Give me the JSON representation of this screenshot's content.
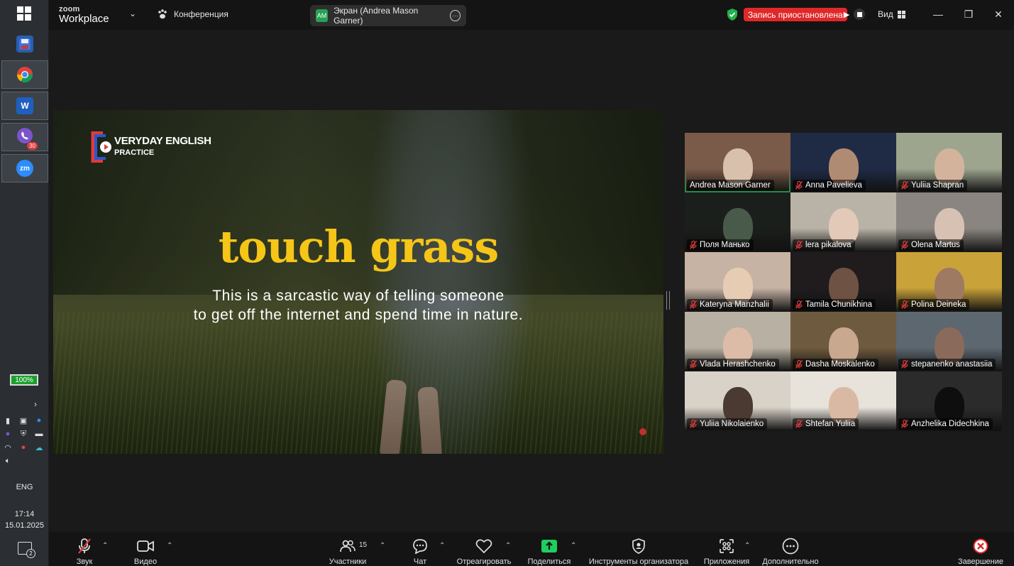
{
  "taskbar": {
    "battery": "100%",
    "language": "ENG",
    "time": "17:14",
    "date": "15.01.2025",
    "notifications": "2",
    "viber_badge": "30",
    "zoom_icon_label": "zm"
  },
  "zoom": {
    "brand_top": "zoom",
    "brand_main": "Workplace",
    "meeting_label": "Конференция",
    "share_pill": {
      "initials": "AM",
      "label": "Экран (Andrea Mason Garner)"
    },
    "recording_label": "Запись приостановлена",
    "view_label": "Вид"
  },
  "shared_screen": {
    "logo_line1": "VERYDAY ENGLISH",
    "logo_line2": "PRACTICE",
    "headline": "touch grass",
    "subline1": "This is a sarcastic way of telling someone",
    "subline2": "to get off the internet and spend time in nature."
  },
  "participants": [
    {
      "name": "Andrea Mason Garner",
      "muted": false,
      "speaking": true,
      "bg": "#7a5a48",
      "face": "#d9c0ad"
    },
    {
      "name": "Anna Pavelieva",
      "muted": true,
      "speaking": false,
      "bg": "#1f2a45",
      "face": "#b08b73"
    },
    {
      "name": "Yuliia Shapran",
      "muted": true,
      "speaking": false,
      "bg": "#9da58e",
      "face": "#d4b39c"
    },
    {
      "name": "Поля Манько",
      "muted": true,
      "speaking": false,
      "bg": "#1b1f1b",
      "face": "#4a5a4a"
    },
    {
      "name": "lera pikalova",
      "muted": true,
      "speaking": false,
      "bg": "#b9b2a6",
      "face": "#e2c9b8"
    },
    {
      "name": "Olena Martus",
      "muted": true,
      "speaking": false,
      "bg": "#8a8580",
      "face": "#d7c1b2"
    },
    {
      "name": "Kateryna Manzhalii",
      "muted": true,
      "speaking": false,
      "bg": "#c7b3a4",
      "face": "#e7ccb4"
    },
    {
      "name": "Tamila Chunikhina",
      "muted": true,
      "speaking": false,
      "bg": "#201c1e",
      "face": "#6e5244"
    },
    {
      "name": "Polina Deineka",
      "muted": true,
      "speaking": false,
      "bg": "#c9a23a",
      "face": "#9e7a62"
    },
    {
      "name": "Vlada Herashchenko",
      "muted": true,
      "speaking": false,
      "bg": "#b8b0a2",
      "face": "#dcbca6"
    },
    {
      "name": "Dasha Moskalenko",
      "muted": true,
      "speaking": false,
      "bg": "#6e5a3e",
      "face": "#c8a88e"
    },
    {
      "name": "stepanenko anastasiia",
      "muted": true,
      "speaking": false,
      "bg": "#5d6770",
      "face": "#8a6a5a"
    },
    {
      "name": "Yuliia Nikolaienko",
      "muted": true,
      "speaking": false,
      "bg": "#d8d2c8",
      "face": "#4a3a32"
    },
    {
      "name": "Shtefan Yuliia",
      "muted": true,
      "speaking": false,
      "bg": "#e7e2da",
      "face": "#d9b9a3"
    },
    {
      "name": "Anzhelika Didechkina",
      "muted": true,
      "speaking": false,
      "bg": "#2b2b2b",
      "face": "#0e0e0e"
    }
  ],
  "toolbar": {
    "audio": "Звук",
    "video": "Видео",
    "participants": "Участники",
    "participants_count": "15",
    "chat": "Чат",
    "react": "Отреагировать",
    "share": "Поделиться",
    "host_tools": "Инструменты организатора",
    "apps": "Приложения",
    "more": "Дополнительно",
    "end": "Завершение"
  },
  "colors": {
    "accent_green": "#2fd96b",
    "recording_red": "#e02828",
    "share_green": "#1fce5f",
    "headline_yellow": "#f5c518",
    "muted_red": "#e03b3b"
  }
}
